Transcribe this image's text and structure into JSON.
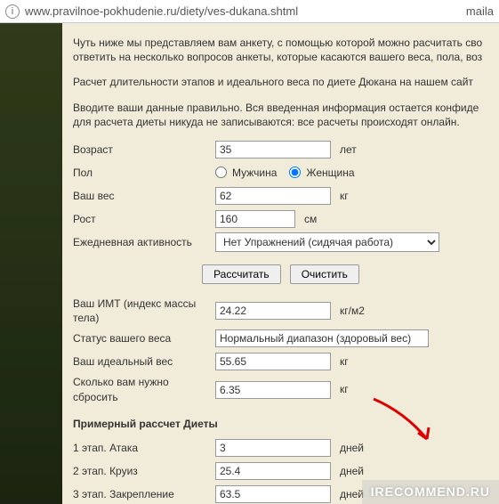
{
  "url": "www.pravilnoe-pokhudenie.ru/diety/ves-dukana.shtml",
  "url_right": "maila",
  "intro": {
    "p1": "Чуть ниже мы представляем вам анкету, с помощью которой можно расчитать сво ответить на несколько вопросов анкеты, которые касаются вашего веса, пола, воз",
    "p2": "Расчет длительности этапов и идеального веса по диете Дюкана на нашем сайт",
    "p3": "Вводите ваши данные правильно. Вся введенная информация остается конфиде для расчета диеты никуда не записываются: все расчеты происходят онлайн."
  },
  "labels": {
    "age": "Возраст",
    "gender": "Пол",
    "weight": "Ваш вес",
    "height": "Рост",
    "activity": "Ежедневная активность",
    "bmi": "Ваш ИМТ (индекс массы тела)",
    "status": "Статус вашего веса",
    "ideal": "Ваш идеальный вес",
    "lose": "Сколько вам нужно сбросить",
    "diet_title": "Примерный рассчет Диеты",
    "stage1": "1 этап. Атака",
    "stage2": "2 этап. Круиз",
    "stage3": "3 этап. Закрепление"
  },
  "units": {
    "years": "лет",
    "kg": "кг",
    "cm": "см",
    "bmi": "кг/м2",
    "days": "дней"
  },
  "gender": {
    "male": "Мужчина",
    "female": "Женщина"
  },
  "values": {
    "age": "35",
    "weight": "62",
    "height": "160",
    "activity": "Нет Упражнений (сидячая работа)",
    "bmi": "24.22",
    "status": "Нормальный диапазон (здоровый вес)",
    "ideal": "55.65",
    "lose": "6.35",
    "stage1": "3",
    "stage2": "25.4",
    "stage3": "63.5"
  },
  "buttons": {
    "calc": "Рассчитать",
    "clear": "Очистить"
  },
  "watermark": "IRECOMMEND.RU"
}
